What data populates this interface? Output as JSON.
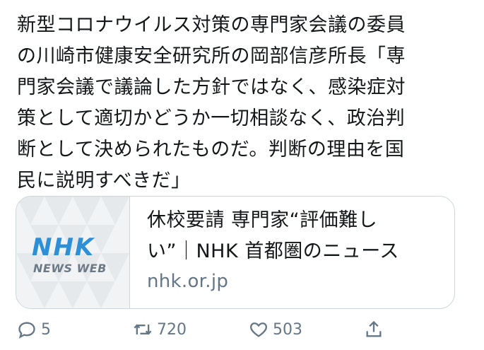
{
  "tweet": {
    "text": "新型コロナウイルス対策の専門家会議の委員\nの川崎市健康安全研究所の岡部信彦所長「専\n門家会議で議論した方針ではなく、感染症対\n策として適切かどうか一切相談なく、政治判\n断として決められたものだ。判断の理由を国\n民に説明すべきだ」"
  },
  "card": {
    "logo_text": "NHK",
    "logo_subtext": "NEWS WEB",
    "title": "休校要請 専門家“評価難し\nい”｜NHK 首都圏のニュース",
    "domain": "nhk.or.jp"
  },
  "actions": {
    "reply_count": "5",
    "retweet_count": "720",
    "like_count": "503"
  },
  "colors": {
    "text": "#14171a",
    "muted": "#657786",
    "border": "#ccd6dd",
    "nhk_blue": "#2f8fd6"
  }
}
